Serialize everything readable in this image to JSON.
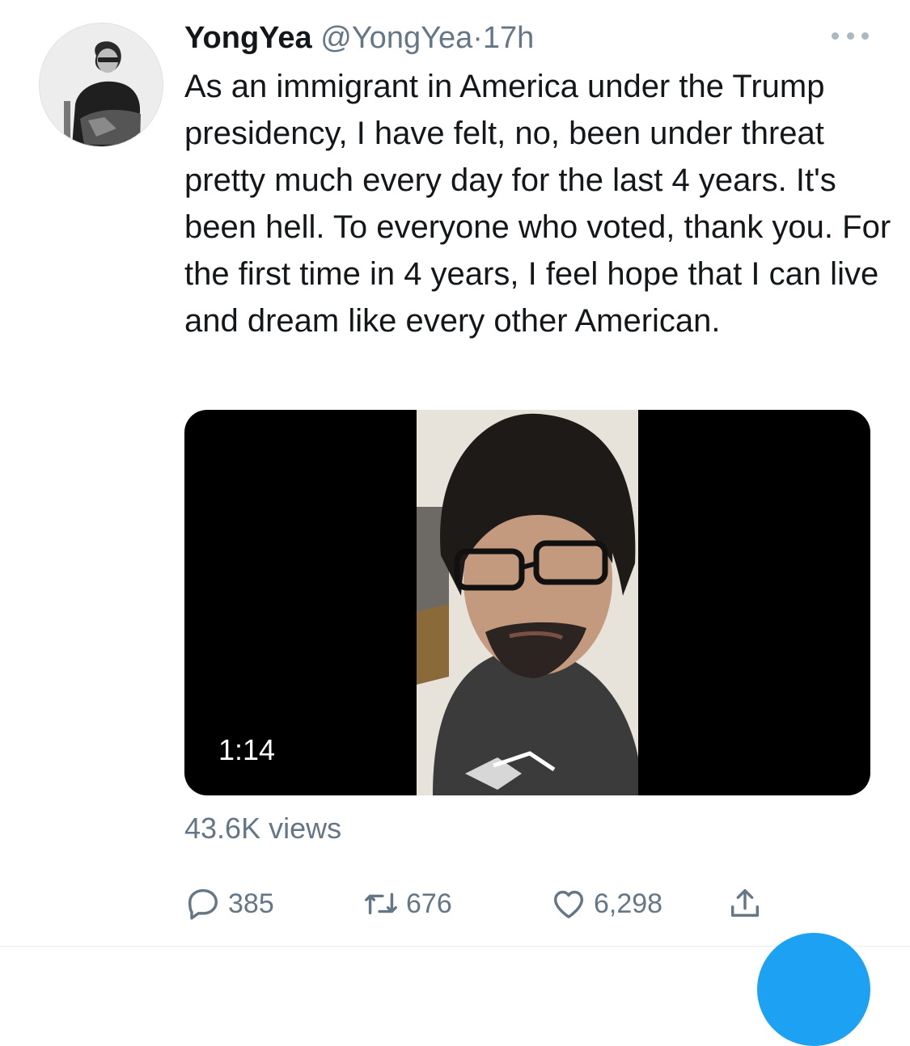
{
  "tweet": {
    "display_name": "YongYea",
    "handle": "@YongYea",
    "separator": "·",
    "time": "17h",
    "text": "As an immigrant in America under the Trump presidency, I have felt, no, been under threat pretty much every day for the last 4 years. It's been hell. To everyone who voted, thank you. For the first time in 4 years, I feel hope that I can live and dream like every other American.",
    "video": {
      "duration": "1:14"
    },
    "views": "43.6K views",
    "actions": {
      "replies": "385",
      "retweets": "676",
      "likes": "6,298"
    }
  },
  "icons": {
    "more": "more-horizontal-icon",
    "reply": "speech-bubble-icon",
    "retweet": "retweet-arrows-icon",
    "like": "heart-outline-icon",
    "share": "share-upload-icon"
  },
  "colors": {
    "text": "#14171a",
    "secondary": "#657786",
    "accent": "#1da1f2",
    "video_bg": "#000000"
  }
}
